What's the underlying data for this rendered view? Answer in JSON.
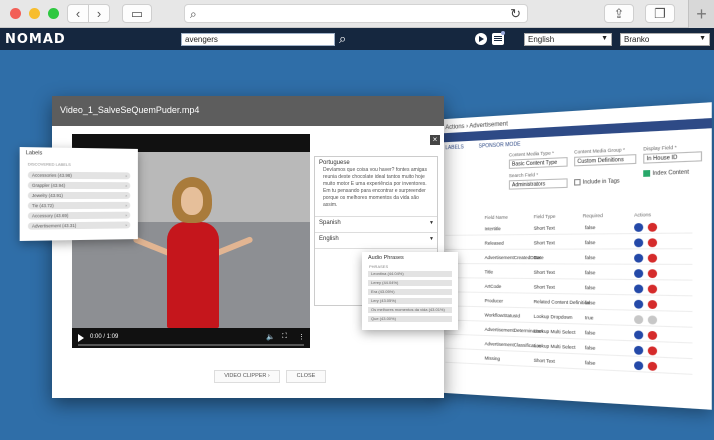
{
  "browser": {
    "url": "",
    "new_tab_label": "+"
  },
  "app": {
    "logo": "NOMAD",
    "search_value": "avengers",
    "language": "English",
    "user": "Branko"
  },
  "modal": {
    "title": "Video_1_SalveSeQuemPuder.mp4",
    "close_label": "×",
    "video_time": "0:00 / 1:09",
    "transcript": {
      "sections": [
        "Portuguese",
        "Spanish",
        "English"
      ],
      "text": "Devíamos que coisa vou haver? fontes amigas reunia deste chocolate ideal tantos muito hoje muito motor E uma experiência por inventores. Em tu pensando para encontrar e surpreender porque os melhores momentos da vida são assim."
    },
    "buttons": {
      "clipper": "VIDEO CLIPPER ›",
      "close": "CLOSE"
    }
  },
  "labels_panel": {
    "title": "Labels",
    "subtitle": "DISCOVERED LABELS",
    "items": [
      "Accessories (43.98)",
      "Grappler (43.94)",
      "Jewelry (43.91)",
      "Tie (43.72)",
      "Accessory (43.69)",
      "Advertisement (43.31)"
    ]
  },
  "audio_panel": {
    "title": "Audio Phrases",
    "subtitle": "PHRASES",
    "items": [
      "Leontina (44.04%)",
      "Lerey (44.04%)",
      "Era (43.05%)",
      "Lery (43.05%)",
      "Os melhores momentos da vida (43.01%)",
      "Que (43.00%)"
    ]
  },
  "adv": {
    "breadcrumb": "Actions › Advertisement",
    "options": [
      "LABELS",
      "SPONSOR MODE"
    ],
    "fields": [
      {
        "label": "Content Media Type *",
        "value": "Basic Content Type"
      },
      {
        "label": "Content Media Group *",
        "value": "Custom Definitions"
      },
      {
        "label": "Display Field *",
        "value": "In House ID"
      },
      {
        "label": "Search Field *",
        "value": "Administrators"
      }
    ],
    "checkboxes": [
      {
        "label": "Include in Tags",
        "checked": false
      },
      {
        "label": "Index Content",
        "checked": true
      }
    ],
    "columns": [
      "Field Name",
      "Field Type",
      "Required",
      "Actions"
    ],
    "rows": [
      {
        "name": "Intertitle",
        "type": "Short Text",
        "req": "false",
        "disabled": false
      },
      {
        "name": "Released",
        "type": "Short Text",
        "req": "false",
        "disabled": false
      },
      {
        "name": "AdvertisementCreatedDate",
        "type": "Date",
        "req": "false",
        "disabled": false
      },
      {
        "name": "Title",
        "type": "Short Text",
        "req": "false",
        "disabled": false
      },
      {
        "name": "ArtCode",
        "type": "Short Text",
        "req": "false",
        "disabled": false
      },
      {
        "name": "Producer",
        "type": "Related Content Definition",
        "req": "false",
        "disabled": false
      },
      {
        "name": "WorkflowStatusId",
        "type": "Lookup Dropdown",
        "req": "true",
        "disabled": true
      },
      {
        "name": "AdvertisementDetermination",
        "type": "Lookup Multi Select",
        "req": "false",
        "disabled": false
      },
      {
        "name": "AdvertisementClassification",
        "type": "Lookup Multi Select",
        "req": "false",
        "disabled": false
      },
      {
        "name": "Missing",
        "type": "Short Text",
        "req": "false",
        "disabled": false
      }
    ]
  }
}
